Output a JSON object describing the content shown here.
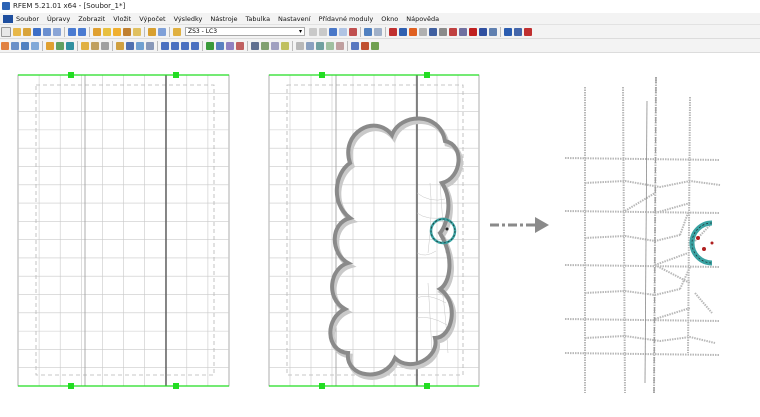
{
  "window": {
    "title": "RFEM 5.21.01 x64 - [Soubor_1*]"
  },
  "menu": {
    "items": [
      "Soubor",
      "Úpravy",
      "Zobrazit",
      "Vložit",
      "Výpočet",
      "Výsledky",
      "Nástroje",
      "Tabulka",
      "Nastavení",
      "Přídavné moduly",
      "Okno",
      "Nápověda"
    ]
  },
  "toolbar": {
    "load_case": "ZS3 - LC3"
  },
  "icons": {
    "app": "rfem-app-icon",
    "arrow": "dash-dot-arrow-icon"
  },
  "colors": {
    "accent": "#2b63b5",
    "support": "#22dd22",
    "cloud": "#888888",
    "ring": "#3aa3a3"
  }
}
